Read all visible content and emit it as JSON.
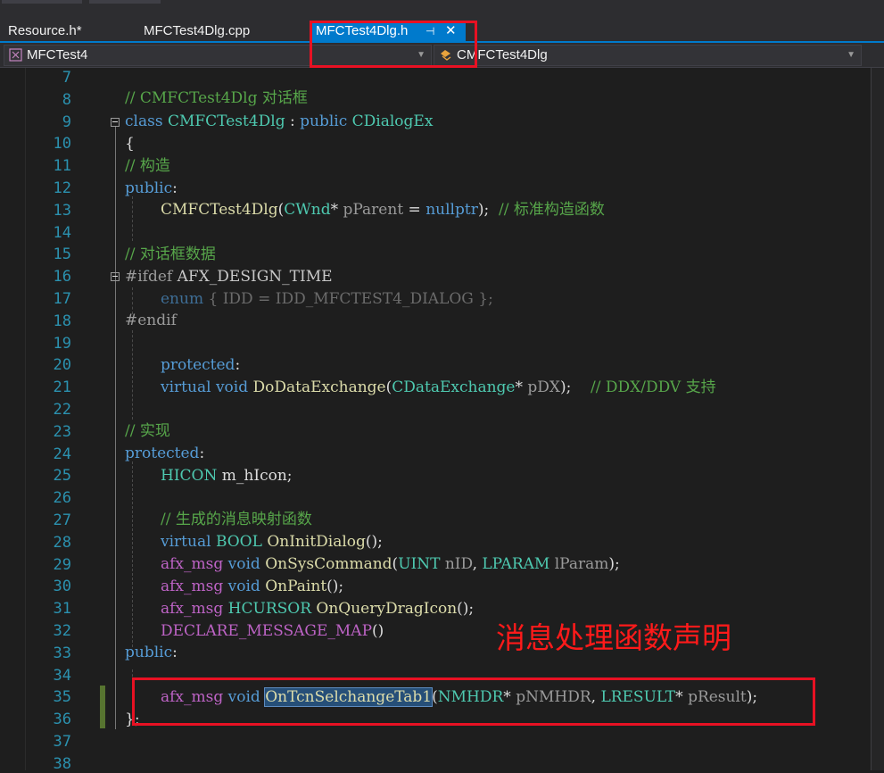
{
  "tabs": [
    {
      "label": "Resource.h*"
    },
    {
      "label": "MFCTest4Dlg.cpp"
    },
    {
      "label": "MFCTest4Dlg.h"
    }
  ],
  "active_tab": {
    "pin_icon": "pin-icon",
    "close_icon": "close-icon"
  },
  "navigation": {
    "project": "MFCTest4",
    "class_scope": "CMFCTest4Dlg"
  },
  "line_numbers": [
    "7",
    "8",
    "9",
    "10",
    "11",
    "12",
    "13",
    "14",
    "15",
    "16",
    "17",
    "18",
    "19",
    "20",
    "21",
    "22",
    "23",
    "24",
    "25",
    "26",
    "27",
    "28",
    "29",
    "30",
    "31",
    "32",
    "33",
    "34",
    "35",
    "36",
    "37",
    "38"
  ],
  "code": {
    "l8": {
      "comment": "// CMFCTest4Dlg 对话框"
    },
    "l9": {
      "kw": "class",
      "name": "CMFCTest4Dlg",
      "colon": " : ",
      "kw2": "public",
      "base": "CDialogEx"
    },
    "l10": {
      "brace": "{"
    },
    "l11": {
      "comment": "// 构造"
    },
    "l12": {
      "kw": "public",
      "colon": ":"
    },
    "l13": {
      "fn": "CMFCTest4Dlg",
      "p1": "(",
      "ty": "CWnd",
      "p2": "* ",
      "param": "pParent",
      "p3": " = ",
      "kw": "nullptr",
      "p4": ");  ",
      "comment": "// 标准构造函数"
    },
    "l15": {
      "comment": "// 对话框数据"
    },
    "l16": {
      "pp": "#ifdef",
      "mac": "AFX_DESIGN_TIME"
    },
    "l17": {
      "kw": "enum",
      "rest": " { IDD = IDD_MFCTEST4_DIALOG };"
    },
    "l18": {
      "pp": "#endif"
    },
    "l20": {
      "kw": "protected",
      "colon": ":"
    },
    "l21": {
      "kw": "virtual",
      "kw2": "void",
      "fn": "DoDataExchange",
      "p1": "(",
      "ty": "CDataExchange",
      "p2": "* ",
      "param": "pDX",
      "p3": ");    ",
      "comment": "// DDX/DDV 支持"
    },
    "l23": {
      "comment": "// 实现"
    },
    "l24": {
      "kw": "protected",
      "colon": ":"
    },
    "l25": {
      "ty": "HICON",
      "rest": " m_hIcon;"
    },
    "l27": {
      "comment": "// 生成的消息映射函数"
    },
    "l28": {
      "kw": "virtual",
      "ty": "BOOL",
      "fn": "OnInitDialog",
      "rest": "();"
    },
    "l29": {
      "mac": "afx_msg",
      "kw": "void",
      "fn": "OnSysCommand",
      "p1": "(",
      "ty": "UINT",
      "param": "nID",
      "p2": ", ",
      "ty2": "LPARAM",
      "param2": "lParam",
      "p3": ");"
    },
    "l30": {
      "mac": "afx_msg",
      "kw": "void",
      "fn": "OnPaint",
      "rest": "();"
    },
    "l31": {
      "mac": "afx_msg",
      "ty": "HCURSOR",
      "fn": "OnQueryDragIcon",
      "rest": "();"
    },
    "l32": {
      "mac": "DECLARE_MESSAGE_MAP",
      "rest": "()"
    },
    "l33": {
      "kw": "public",
      "colon": ":"
    },
    "l35": {
      "mac": "afx_msg",
      "kw": "void",
      "fn": "OnTcnSelchangeTab1",
      "p1": "(",
      "ty": "NMHDR",
      "p2": "* ",
      "param": "pNMHDR",
      "p3": ", ",
      "ty2": "LRESULT",
      "p4": "* ",
      "param2": "pResult",
      "p5": ");"
    },
    "l36": {
      "brace": "};"
    }
  },
  "annotation": "消息处理函数声明",
  "colors": {
    "accent": "#007acc",
    "highlight_box": "#e81123",
    "annotation_text": "#ff1a1a",
    "comment": "#57a64a",
    "keyword": "#569cd6",
    "type": "#4ec9b0",
    "function": "#dcdcaa",
    "line_number": "#2b91af"
  }
}
